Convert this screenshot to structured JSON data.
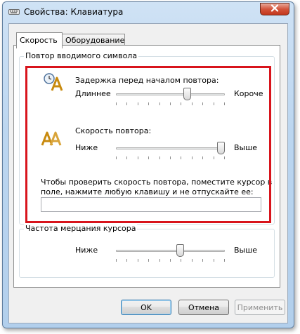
{
  "window": {
    "title": "Свойства: Клавиатура"
  },
  "tabs": [
    {
      "label": "Скорость",
      "active": true
    },
    {
      "label": "Оборудование",
      "active": false
    }
  ],
  "repeat_group": {
    "title": "Повтор вводимого символа",
    "delay": {
      "label": "Задержка перед началом повтора:",
      "min_label": "Длиннее",
      "max_label": "Короче",
      "value": 0.67
    },
    "rate": {
      "label": "Скорость повтора:",
      "min_label": "Ниже",
      "max_label": "Выше",
      "value": 1.0
    },
    "test": {
      "label_line1": "Чтобы проверить скорость повтора, поместите курсор в",
      "label_line2": "поле, нажмите любую клавишу и не отпускайте ее:",
      "value": "",
      "placeholder": ""
    }
  },
  "cursor_group": {
    "title": "Частота мерцания курсора",
    "blink": {
      "min_label": "Ниже",
      "max_label": "Выше",
      "value": 0.6
    }
  },
  "buttons": {
    "ok": "OK",
    "cancel": "Отмена",
    "apply": "Применить"
  },
  "colors": {
    "highlight": "#d8141c",
    "close_button": "#c2361c"
  },
  "icons": {
    "title": "keyboard-icon",
    "delay": "clock-letter-a-icon",
    "rate": "double-letter-a-icon",
    "close": "close-icon"
  }
}
